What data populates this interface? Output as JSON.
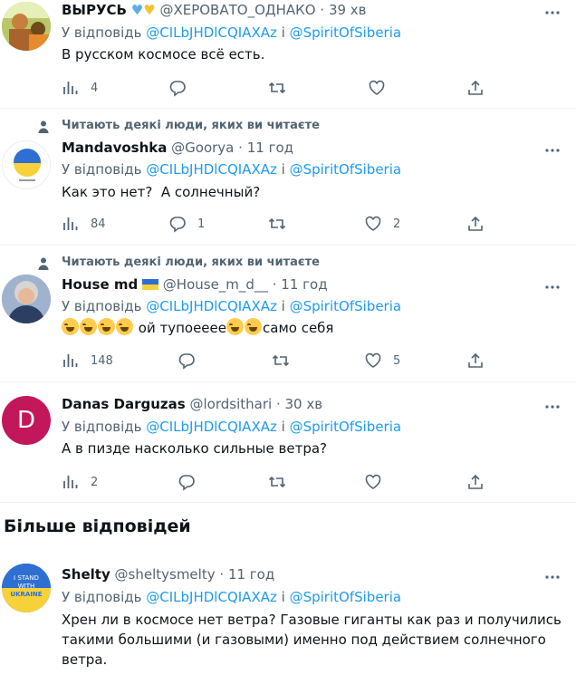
{
  "colors": {
    "accent": "#1d9bf0",
    "muted": "#536471",
    "text": "#0f1419"
  },
  "reply_prefix": "У відповідь",
  "reply_and": "і",
  "mention1": "@CILbJHDlCQIAXAz",
  "mention2": "@SpiritOfSiberia",
  "social_context": "Читають деякі люди, яких ви читаєте",
  "more_replies_heading": "Більше відповідей",
  "tweets": [
    {
      "name": "ВЫРУСЬ",
      "handle": "@ХЕРОВАТО_ОДНАКО",
      "time": "39 хв",
      "text": "В русском космосе всё есть.",
      "views": "4",
      "replies": "",
      "retweets": "",
      "likes": ""
    },
    {
      "name": "Mandavoshka",
      "handle": "@Goorya",
      "time": "11 год",
      "text": "Как это нет?  А солнечный?",
      "views": "84",
      "replies": "1",
      "retweets": "",
      "likes": "2"
    },
    {
      "name": "House md",
      "handle": "@House_m_d__",
      "time": "11 год",
      "text": "ой тупоееее",
      "text_end": "само себя",
      "views": "148",
      "replies": "",
      "retweets": "",
      "likes": "5"
    },
    {
      "name": "Danas Darguzas",
      "handle": "@lordsithari",
      "time": "30 хв",
      "avatar_letter": "D",
      "text": "А в пизде насколько сильные ветра?",
      "views": "2",
      "replies": "",
      "retweets": "",
      "likes": ""
    },
    {
      "name": "Shelty",
      "handle": "@sheltysmelty",
      "time": "11 год",
      "avatar_lines": [
        "I STAND",
        "WITH",
        "UKRAINE"
      ],
      "text": "Хрен ли в космосе нет ветра? Газовые гиганты как раз и получились такими большими (и газовыми) именно под действием солнечного ветра."
    }
  ]
}
